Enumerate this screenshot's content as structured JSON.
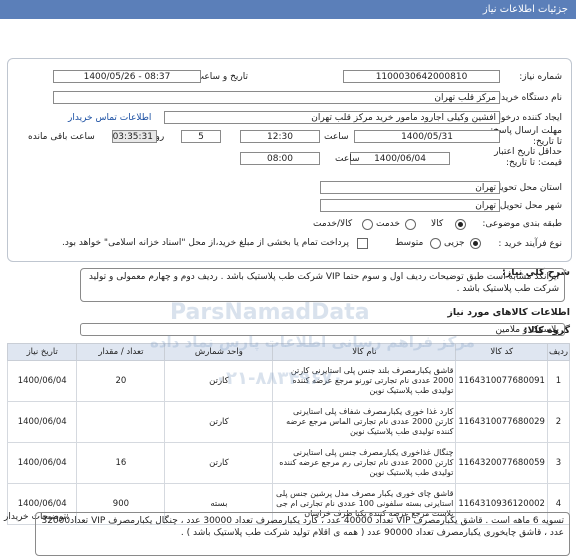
{
  "title": "جزئیات اطلاعات نیاز",
  "fields": {
    "need_number_label": "شماره نیاز:",
    "need_number": "1100030642000810",
    "announce_label": "تاریخ و ساعت اعلان عمومی:",
    "announce_value": "1400/05/26 - 08:37",
    "buyer_label": "نام دستگاه خریدار:",
    "buyer": "مرکز قلب تهران",
    "creator_label": "ایجاد کننده درخواست:",
    "creator": "افشین وکیلی اجارود مامور خرید مرکز قلب تهران",
    "contact_link": "اطلاعات تماس خریدار",
    "deadline_label": "مهلت ارسال پاسخ: تا تاریخ:",
    "deadline_date": "1400/05/31",
    "time_label": "ساعت",
    "deadline_time": "12:30",
    "days_value": "5",
    "days_label": "روز و",
    "remaining_time": "03:35:31",
    "remaining_label": "ساعت باقی مانده",
    "min_validity_label": "حداقل تاریخ اعتبار قیمت: تا تاریخ:",
    "validity_date": "1400/06/04",
    "validity_time_label": "ساعت",
    "validity_time": "08:00",
    "province_label": "استان محل تحویل:",
    "province": "تهران",
    "city_label": "شهر محل تحویل:",
    "city": "تهران",
    "category_label": "طبقه بندی موضوعی:",
    "cat_goods": "کالا",
    "cat_service": "خدمت",
    "cat_both": "کالا/خدمت",
    "process_label": "نوع فرآیند خرید :",
    "proc_partial": "جزیی",
    "proc_medium": "متوسط",
    "payment_note": "پرداخت تمام یا بخشی از مبلغ خرید،از محل \"اسناد خزانه اسلامی\" خواهد بود."
  },
  "summary": {
    "label": "شرح کلی نیاز:",
    "text": "ایرانکد مشابه است طبق توضیحات ردیف اول و سوم حتما VIP شرکت طب پلاستیک باشد . ردیف دوم و چهارم معمولی و تولید شرکت طب پلاستیک باشد ."
  },
  "goods_info_label": "اطلاعات کالاهای مورد نیاز",
  "group": {
    "label": "گروه کالا:",
    "value": "پلاستیک و ملامین"
  },
  "table": {
    "headers": [
      "ردیف",
      "کد کالا",
      "نام کالا",
      "واحد شمارش",
      "تعداد / مقدار",
      "تاریخ نیاز"
    ],
    "rows": [
      [
        "1",
        "1164310077680091",
        "قاشق یکبارمصرف بلند جنس پلی استایرنی کارتن 2000 عددی نام تجارتی تورنو مرجع عرضه کننده تولیدی طب پلاستیک نوین",
        "کارتن",
        "20",
        "1400/06/04"
      ],
      [
        "2",
        "1164310077680029",
        "کارد غذا خوری یکبارمصرف شفاف پلی استایرنی کارتن 2000 عددی نام تجارتی الماس مرجع عرضه کننده تولیدی طب پلاستیک نوین",
        "کارتن",
        "",
        "1400/06/04"
      ],
      [
        "3",
        "1164320077680059",
        "چنگال غذاخوری یکبارمصرف جنس پلی استایرنی کارتن 2000 عددی نام تجارتی رم مرجع عرضه کننده تولیدی طب پلاستیک نوین",
        "کارتن",
        "16",
        "1400/06/04"
      ],
      [
        "4",
        "1164310936120002",
        "قاشق چای خوری یکبار مصرف مدل پرشین جنس پلی استایرنی بسته سلفونی 100 عددی نام تجارتی ام جی پلاست مرجع عرضه کننده یکتا ظرف خراسان",
        "بسته",
        "900",
        "1400/06/04"
      ]
    ]
  },
  "notes": {
    "label": "توضیحات خریدار:",
    "text": "تسویه 6 ماهه است . قاشق یکبارمصرف VIP تعداد 40000 عدد ، کارد یکبارمصرف تعداد 30000 عدد ، چنگال یکبارمصرف VIP تعداد32000 عدد ، قاشق چایخوری یکبارمصرف تعداد 90000 عدد  ( همه ی اقلام تولید شرکت طب پلاستیک باشد ) ."
  },
  "watermark": {
    "brand": "ParsNamadData",
    "fa": "مرکز فراهم رسانی اطلاعات پارس نماد داده",
    "phone": "۰۲۱-۸۸۳۴۹۶۷۰"
  },
  "colors": {
    "titlebar": "#5b7fb9",
    "table_header": "#dfe6f1",
    "link": "#1a4fa3"
  }
}
